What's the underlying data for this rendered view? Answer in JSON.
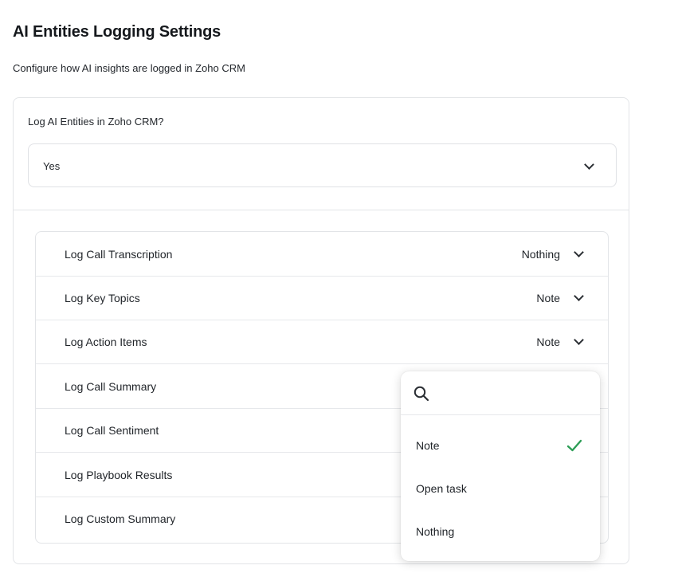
{
  "page": {
    "title": "AI Entities Logging Settings",
    "subtitle": "Configure how AI insights are logged in Zoho CRM"
  },
  "main_setting": {
    "label": "Log AI Entities in Zoho CRM?",
    "value": "Yes",
    "icon": "chevron-down-icon"
  },
  "rows": [
    {
      "label": "Log Call Transcription",
      "value": "Nothing"
    },
    {
      "label": "Log Key Topics",
      "value": "Note"
    },
    {
      "label": "Log Action Items",
      "value": "Note"
    },
    {
      "label": "Log Call Summary",
      "value": ""
    },
    {
      "label": "Log Call Sentiment",
      "value": ""
    },
    {
      "label": "Log Playbook Results",
      "value": ""
    },
    {
      "label": "Log Custom Summary",
      "value": ""
    }
  ],
  "dropdown": {
    "search_placeholder": "",
    "options": [
      {
        "label": "Note",
        "selected": true
      },
      {
        "label": "Open task",
        "selected": false
      },
      {
        "label": "Nothing",
        "selected": false
      }
    ]
  },
  "colors": {
    "accent_check": "#2e9e57",
    "border": "#e2e4e7",
    "text": "#1f2328"
  }
}
